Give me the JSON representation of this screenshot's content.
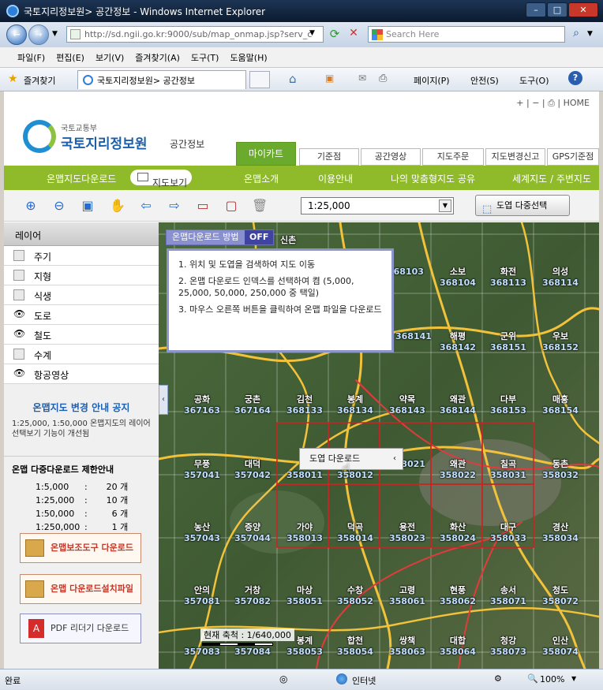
{
  "window": {
    "title": "국토지리정보원> 공간정보 - Windows Internet Explorer"
  },
  "navbar": {
    "url": "http://sd.ngii.go.kr:9000/sub/map_onmap.jsp?serv_c",
    "search_placeholder": "Search Here"
  },
  "menu": [
    "파일(F)",
    "편집(E)",
    "보기(V)",
    "즐겨찾기(A)",
    "도구(T)",
    "도움말(H)"
  ],
  "favbar": {
    "favorites": "즐겨찾기",
    "tab_title": "국토지리정보원> 공간정보",
    "tools": [
      "페이지(P)",
      "안전(S)",
      "도구(O)"
    ]
  },
  "header": {
    "top_links": "+ | − | ⎙ | HOME",
    "ministry": "국토교통부",
    "org": "국토지리정보원",
    "sub": "공간정보"
  },
  "tabs": [
    "마이카트",
    "기준점",
    "공간영상",
    "지도주문",
    "지도변경신고",
    "GPS기준점"
  ],
  "green_nav": {
    "left": "온맵지도다운로드",
    "view_btn": "지도보기",
    "items": [
      "온맵소개",
      "이용안내",
      "나의 맞춤형지도 공유",
      "세계지도 / 주변지도"
    ]
  },
  "toolbar": {
    "scale_value": "1:25,000",
    "multi_select": "도엽 다중선택"
  },
  "sidebar": {
    "title": "레이어",
    "layers": [
      {
        "label": "주기",
        "visible": false
      },
      {
        "label": "지형",
        "visible": false
      },
      {
        "label": "식생",
        "visible": false
      },
      {
        "label": "도로",
        "visible": true
      },
      {
        "label": "철도",
        "visible": true
      },
      {
        "label": "수계",
        "visible": false
      },
      {
        "label": "항공영상",
        "visible": true
      }
    ],
    "notice_title": "온맵지도 변경 안내 공지",
    "notice_text": "1:25,000, 1:50,000 온맵지도의 레이어 선택보기 기능이 개선됨",
    "limit_title": "온맵 다중다운로드 제한안내",
    "limits": [
      {
        "scale": "1:5,000",
        "count": "20 개"
      },
      {
        "scale": "1:25,000",
        "count": "10 개"
      },
      {
        "scale": "1:50,000",
        "count": "6 개"
      },
      {
        "scale": "1:250,000",
        "count": "1 개"
      }
    ],
    "buttons": [
      "온맵보조도구 다운로드",
      "온맵 다운로드설치파일",
      "PDF 리더기 다운로드"
    ]
  },
  "map": {
    "download_mode_label": "온맵다운로드 방법",
    "download_mode_state": "OFF",
    "instructions": [
      "1. 위치 및 도엽을 검색하여 지도 이동",
      "2. 온맵 다운로드 인덱스를 선택하여 켬 (5,000, 25,000, 50,000, 250,000 중 택일)",
      "3. 마우스 오른쪽 버튼을 클릭하여 온맵 파일을 다운로드"
    ],
    "context_menu_item": "도엽 다운로드",
    "scale_text": "현재 축척 : 1/640,000",
    "cells": [
      {
        "name": "신촌",
        "code": ""
      },
      {
        "name": "",
        "code": "368103"
      },
      {
        "name": "소보",
        "code": "368104"
      },
      {
        "name": "화전",
        "code": "368113"
      },
      {
        "name": "의성",
        "code": "368114"
      },
      {
        "name": "",
        "code": "368141"
      },
      {
        "name": "해평",
        "code": "368142"
      },
      {
        "name": "군위",
        "code": "368151"
      },
      {
        "name": "우보",
        "code": "368152"
      },
      {
        "name": "공화",
        "code": "367163"
      },
      {
        "name": "궁촌",
        "code": "367164"
      },
      {
        "name": "김천",
        "code": "368133"
      },
      {
        "name": "봉계",
        "code": "368134"
      },
      {
        "name": "약목",
        "code": "368143"
      },
      {
        "name": "왜관",
        "code": "368144"
      },
      {
        "name": "다부",
        "code": "368153"
      },
      {
        "name": "매흥",
        "code": "368154"
      },
      {
        "name": "무풍",
        "code": "357041"
      },
      {
        "name": "대덕",
        "code": "357042"
      },
      {
        "name": "",
        "code": "358011"
      },
      {
        "name": "",
        "code": "358012"
      },
      {
        "name": "",
        "code": "358021"
      },
      {
        "name": "왜관",
        "code": "358022"
      },
      {
        "name": "칠곡",
        "code": "358031"
      },
      {
        "name": "동촌",
        "code": "358032"
      },
      {
        "name": "농산",
        "code": "357043"
      },
      {
        "name": "증양",
        "code": "357044"
      },
      {
        "name": "가야",
        "code": "358013"
      },
      {
        "name": "덕곡",
        "code": "358014"
      },
      {
        "name": "용전",
        "code": "358023"
      },
      {
        "name": "화산",
        "code": "358024"
      },
      {
        "name": "대구",
        "code": "358033"
      },
      {
        "name": "경산",
        "code": "358034"
      },
      {
        "name": "안의",
        "code": "357081"
      },
      {
        "name": "거창",
        "code": "357082"
      },
      {
        "name": "마상",
        "code": "358051"
      },
      {
        "name": "수창",
        "code": "358052"
      },
      {
        "name": "고령",
        "code": "358061"
      },
      {
        "name": "현풍",
        "code": "358062"
      },
      {
        "name": "송서",
        "code": "358071"
      },
      {
        "name": "청도",
        "code": "358072"
      },
      {
        "name": "",
        "code": "357083"
      },
      {
        "name": "",
        "code": "357084"
      },
      {
        "name": "봉계",
        "code": "358053"
      },
      {
        "name": "합천",
        "code": "358054"
      },
      {
        "name": "쌍책",
        "code": "358063"
      },
      {
        "name": "대합",
        "code": "358064"
      },
      {
        "name": "청강",
        "code": "358073"
      },
      {
        "name": "인산",
        "code": "358074"
      }
    ]
  },
  "status": {
    "left": "완료",
    "zone": "인터넷",
    "zoom": "100%"
  }
}
